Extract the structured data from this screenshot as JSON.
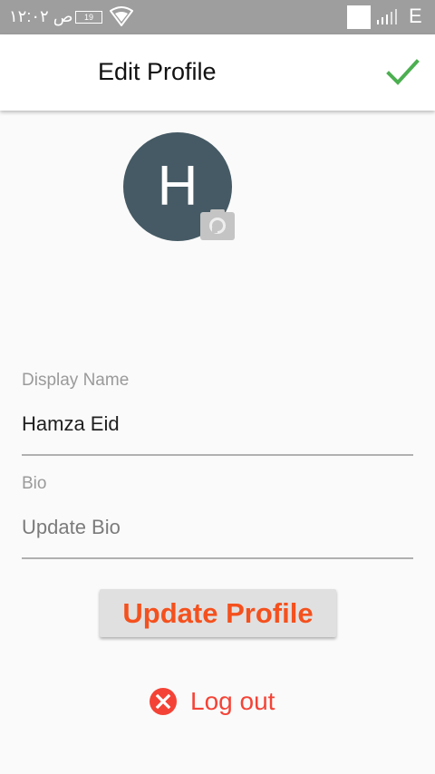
{
  "status_bar": {
    "time": "ص ١٢:٠٢",
    "battery": "19",
    "network": "E",
    "icons": [
      "wifi-icon",
      "signal-icon"
    ]
  },
  "app_bar": {
    "title": "Edit Profile",
    "confirm_icon": "check-icon",
    "accent_color": "#4caf50"
  },
  "profile": {
    "avatar_initial": "H",
    "avatar_color": "#455a64",
    "camera_icon": "camera-icon"
  },
  "form": {
    "display_name": {
      "label": "Display Name",
      "value": "Hamza Eid"
    },
    "bio": {
      "label": "Bio",
      "placeholder": "Update Bio"
    }
  },
  "actions": {
    "update_label": "Update Profile",
    "update_color": "#f4511e",
    "logout_label": "Log out",
    "logout_color": "#f44336",
    "logout_icon": "cancel-icon"
  }
}
